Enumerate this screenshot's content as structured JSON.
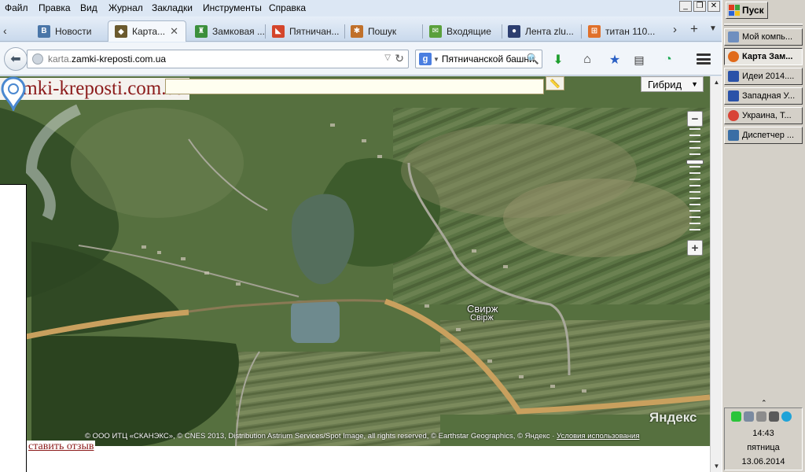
{
  "menu": [
    "Файл",
    "Правка",
    "Вид",
    "Журнал",
    "Закладки",
    "Инструменты",
    "Справка"
  ],
  "tabs": [
    {
      "label": "Новости",
      "icon": "vk-icon",
      "color": "#4a76a8",
      "glyph": "В"
    },
    {
      "label": "Карта...",
      "icon": "castle-icon",
      "color": "#6b5a2e",
      "glyph": "◆",
      "active": true
    },
    {
      "label": "Замковая ...",
      "icon": "tower-icon",
      "color": "#3b8f3b",
      "glyph": "♜"
    },
    {
      "label": "Пятничан...",
      "icon": "maps-icon",
      "color": "#d4452b",
      "glyph": "◣"
    },
    {
      "label": "Пошук",
      "icon": "search-site-icon",
      "color": "#c0702a",
      "glyph": "✱"
    },
    {
      "label": "Входящие",
      "icon": "mail-icon",
      "color": "#5aa03c",
      "glyph": "✉"
    },
    {
      "label": "Лента zlu...",
      "icon": "user-icon",
      "color": "#2c3e70",
      "glyph": "●"
    },
    {
      "label": "титан 110...",
      "icon": "windows-icon",
      "color": "#e0702a",
      "glyph": "⊞"
    }
  ],
  "url": {
    "prefix": "karta.",
    "domain": "zamki-kreposti.com.ua"
  },
  "search": {
    "engine": "g",
    "value": "Пятничанской башни"
  },
  "map": {
    "site_title": "zamki-kreposti.com.ua",
    "layer": "Гибрид",
    "places": [
      {
        "name": "Свирж"
      },
      {
        "name": "Свірж"
      }
    ],
    "watermark": "Яндекс",
    "copyright": "© ООО ИТЦ «СКАНЭКС», © CNES 2013, Distribution Astrium Services/Spot Image, all rights reserved, © Earthstar Geographics, © Яндекс ·",
    "terms_link": "Условия использования",
    "review_link": "ставить отзыв",
    "zoom_level": 0.7
  },
  "taskbar": {
    "start": "Пуск",
    "items": [
      {
        "label": "Мой компь...",
        "icon": "computer-icon",
        "color": "#6f8fbf"
      },
      {
        "label": "Карта Зам...",
        "icon": "firefox-icon",
        "color": "#e06a1a",
        "active": true
      },
      {
        "label": "Идеи 2014....",
        "icon": "word-icon",
        "color": "#2a52a8"
      },
      {
        "label": "Западная У...",
        "icon": "word-icon",
        "color": "#2a52a8"
      },
      {
        "label": "Украина, Т...",
        "icon": "chrome-icon",
        "color": "#d84436"
      },
      {
        "label": "Диспетчер ...",
        "icon": "monitor-icon",
        "color": "#3a6ea5"
      }
    ],
    "time": "14:43",
    "day": "пятница",
    "date": "13.06.2014"
  }
}
